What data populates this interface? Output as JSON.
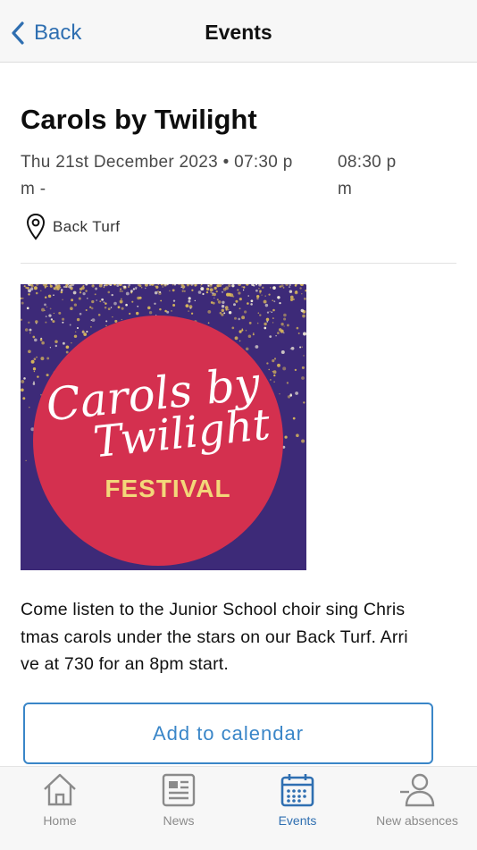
{
  "header": {
    "back_label": "Back",
    "title": "Events"
  },
  "event": {
    "title": "Carols by Twilight",
    "date_start_line1": "Thu 21st December 2023 • 07:30 p",
    "date_start_line2": "m -",
    "date_end_line1": "08:30 p",
    "date_end_line2": "m",
    "location": "Back Turf",
    "poster": {
      "line1": "Carols by",
      "line2": "Twilight",
      "line3": "FESTIVAL",
      "colors": {
        "background": "#3d2a78",
        "circle": "#d4304f",
        "festival": "#f3d77a",
        "script": "#ffffff",
        "glitter": "#d9b85a"
      }
    },
    "description_lines": [
      "Come listen to the Junior School choir sing Chris",
      "tmas carols under the stars on our Back Turf. Arri",
      "ve at 730 for an 8pm start."
    ],
    "add_to_calendar_label": "Add to calendar"
  },
  "tabs": [
    {
      "label": "Home",
      "icon": "home-icon",
      "active": false
    },
    {
      "label": "News",
      "icon": "news-icon",
      "active": false
    },
    {
      "label": "Events",
      "icon": "calendar-icon",
      "active": true
    },
    {
      "label": "New absences",
      "icon": "person-minus-icon",
      "active": false
    }
  ],
  "colors": {
    "accent": "#2f6fb1",
    "button_border": "#3a86c8",
    "inactive_tab": "#8b8b8b"
  }
}
